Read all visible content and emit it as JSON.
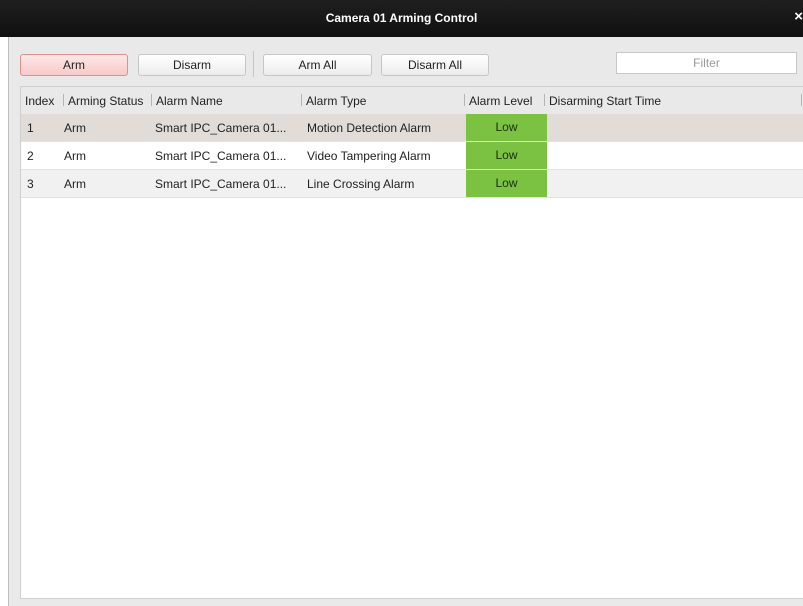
{
  "window": {
    "title": "Camera 01 Arming Control",
    "close_glyph": "×"
  },
  "toolbar": {
    "arm_label": "Arm",
    "disarm_label": "Disarm",
    "arm_all_label": "Arm All",
    "disarm_all_label": "Disarm All",
    "filter_placeholder": "Filter"
  },
  "table": {
    "columns": [
      "Index",
      "Arming Status",
      "Alarm Name",
      "Alarm Type",
      "Alarm Level",
      "Disarming Start Time"
    ],
    "rows": [
      {
        "index": "1",
        "status": "Arm",
        "name": "Smart IPC_Camera 01...",
        "type": "Motion Detection Alarm",
        "level": "Low",
        "start_time": ""
      },
      {
        "index": "2",
        "status": "Arm",
        "name": "Smart IPC_Camera 01...",
        "type": "Video Tampering Alarm",
        "level": "Low",
        "start_time": ""
      },
      {
        "index": "3",
        "status": "Arm",
        "name": "Smart IPC_Camera 01...",
        "type": "Line Crossing Alarm",
        "level": "Low",
        "start_time": ""
      }
    ]
  },
  "colors": {
    "title_bar": "#141414",
    "level_low": "#7bc142",
    "arm_button": "#f8c9c9",
    "selected_row": "#e1dcd7"
  }
}
